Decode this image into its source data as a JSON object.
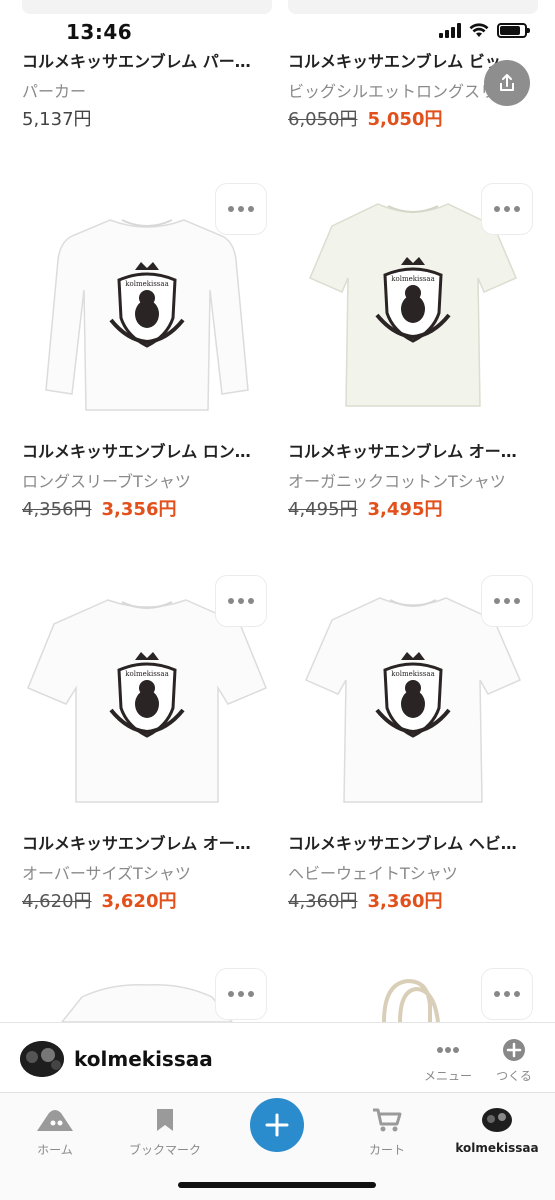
{
  "status": {
    "time": "13:46"
  },
  "products": [
    {
      "title": "コルメキッサエンブレム パー…",
      "type": "パーカー",
      "old_price": "",
      "price": "5,137円"
    },
    {
      "title": "コルメキッサエンブレム ビッ…",
      "type": "ビッグシルエットロングスリー",
      "old_price": "6,050円",
      "price": "5,050円"
    },
    {
      "title": "コルメキッサエンブレム ロン…",
      "type": "ロングスリーブTシャツ",
      "old_price": "4,356円",
      "price": "3,356円"
    },
    {
      "title": "コルメキッサエンブレム オー…",
      "type": "オーガニックコットンTシャツ",
      "old_price": "4,495円",
      "price": "3,495円"
    },
    {
      "title": "コルメキッサエンブレム オー…",
      "type": "オーバーサイズTシャツ",
      "old_price": "4,620円",
      "price": "3,620円"
    },
    {
      "title": "コルメキッサエンブレム ヘビ…",
      "type": "ヘビーウェイトTシャツ",
      "old_price": "4,360円",
      "price": "3,360円"
    }
  ],
  "emblem_text": "kolmekissaa",
  "shop_bar": {
    "name": "kolmekissaa",
    "menu_label": "メニュー",
    "create_label": "つくる"
  },
  "nav": {
    "home": "ホーム",
    "bookmark": "ブックマーク",
    "cart": "カート",
    "profile": "kolmekissaa"
  },
  "colors": {
    "sale": "#e2501c",
    "accent": "#2b8ccd",
    "muted": "#8a8a8a"
  }
}
